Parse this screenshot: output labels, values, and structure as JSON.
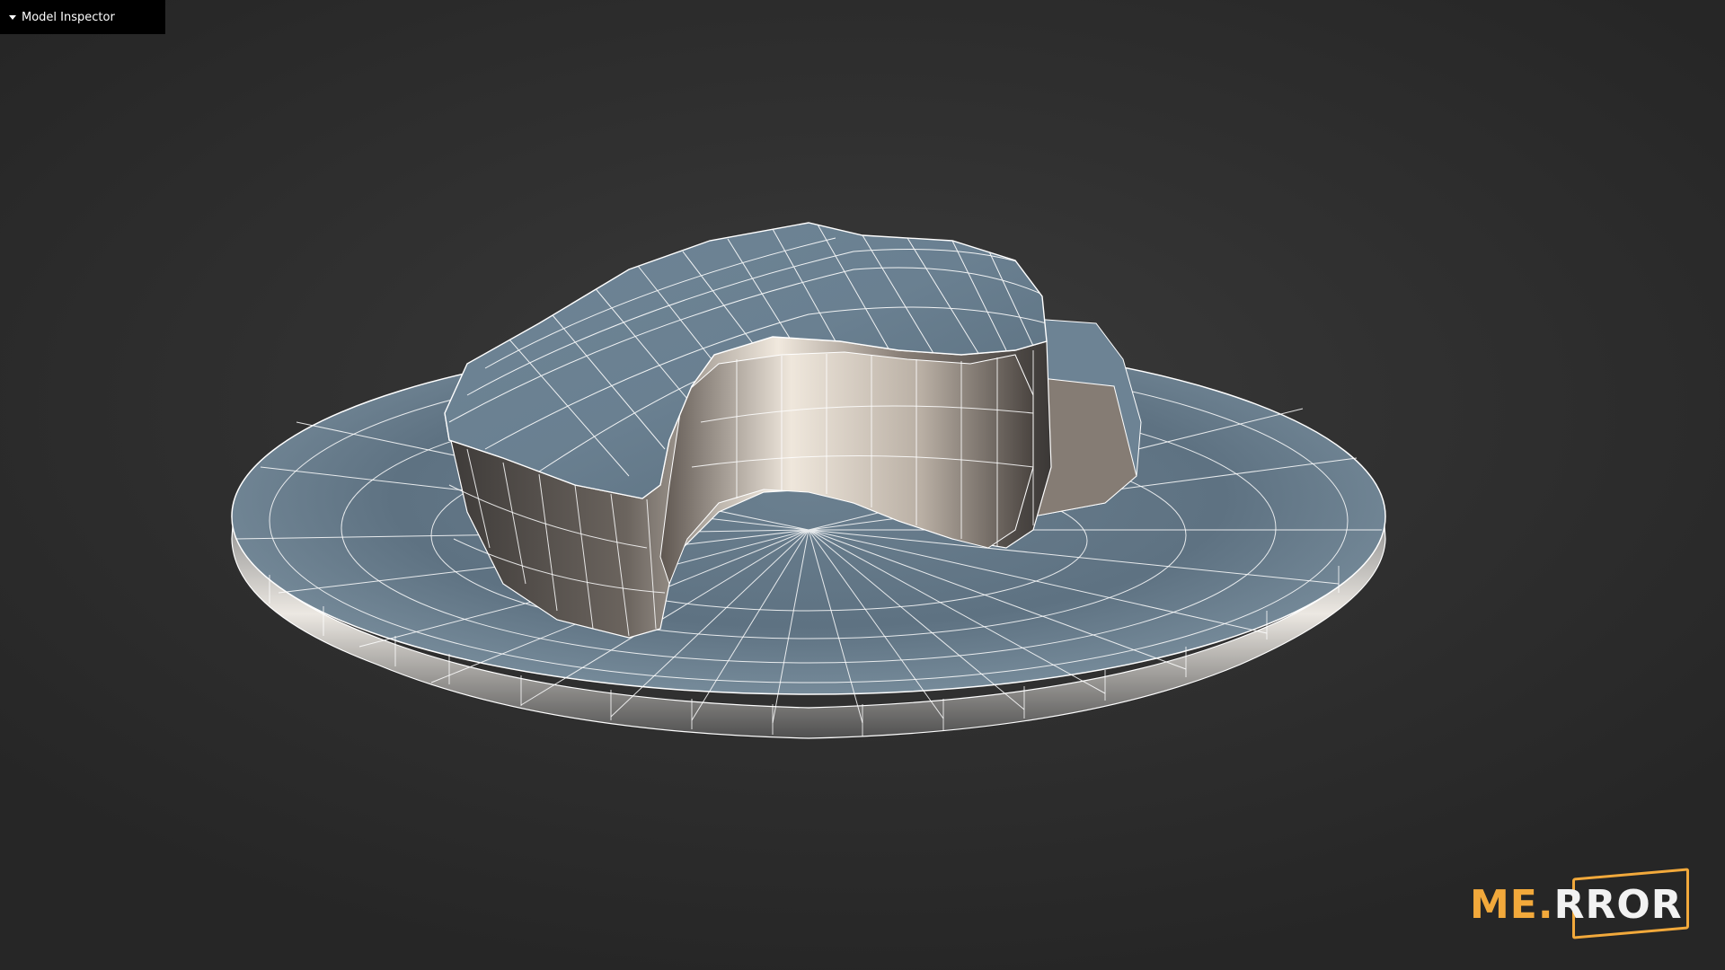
{
  "panel": {
    "title": "Model Inspector",
    "toggle_icon": "caret-down-icon"
  },
  "viewport": {
    "background": "#333333",
    "model": "wireframe-shaded-cake-slice-on-plate",
    "wire_color": "#ffffff",
    "surface_color": "#6d8393"
  },
  "logo": {
    "part1": "ME.",
    "part2": "RROR",
    "accent": "#f2a93b"
  }
}
